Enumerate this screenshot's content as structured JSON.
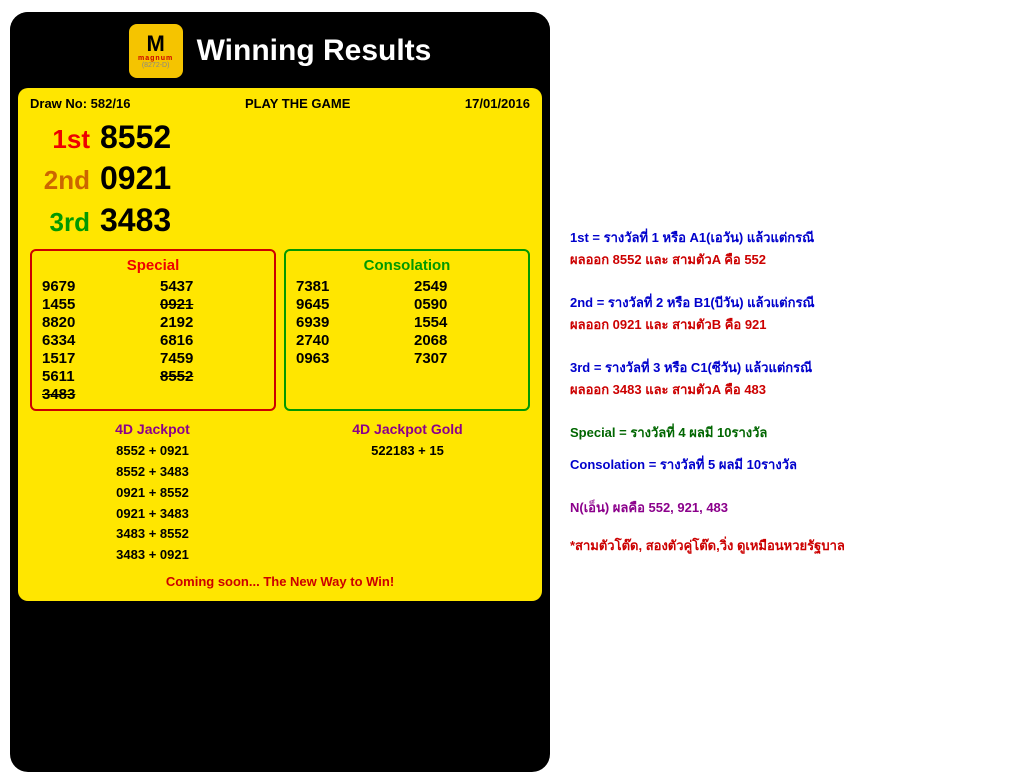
{
  "header": {
    "title": "Winning Results",
    "logo_m": "M",
    "logo_magnum": "magnum",
    "logo_sub": "(8272-D)"
  },
  "draw": {
    "draw_no_label": "Draw No: 582/16",
    "play_label": "PLAY THE GAME",
    "date": "17/01/2016"
  },
  "main_results": {
    "first": {
      "rank": "1st",
      "number": "8552"
    },
    "second": {
      "rank": "2nd",
      "number": "0921"
    },
    "third": {
      "rank": "3rd",
      "number": "3483"
    }
  },
  "special": {
    "title": "Special",
    "numbers": [
      "9679",
      "5437",
      "1455",
      "0921",
      "8820",
      "2192",
      "6334",
      "6816",
      "1517",
      "7459",
      "5611",
      "8552",
      "3483",
      ""
    ],
    "strikethrough": [
      "0921",
      "8552",
      "3483"
    ]
  },
  "consolation": {
    "title": "Consolation",
    "numbers": [
      "7381",
      "2549",
      "9645",
      "0590",
      "6939",
      "1554",
      "2740",
      "2068",
      "0963",
      "7307"
    ]
  },
  "jackpot": {
    "title": "4D Jackpot",
    "combinations": [
      "8552 + 0921",
      "8552 + 3483",
      "0921 + 8552",
      "0921 + 3483",
      "3483 + 8552",
      "3483 + 0921"
    ]
  },
  "jackpot_gold": {
    "title": "4D Jackpot Gold",
    "value": "522183 + 15"
  },
  "coming_soon": "Coming soon... The New Way to Win!",
  "annotations": {
    "line1": "1st = รางวัลที่ 1 หรือ A1(เอวัน) แล้วแต่กรณี",
    "line2": "ผลออก 8552  และ   สามตัวA คือ 552",
    "line3": "2nd = รางวัลที่ 2 หรือ B1(บีวัน) แล้วแต่กรณี",
    "line4": "ผลออก 0921  และ   สามตัวB คือ 921",
    "line5": "3rd = รางวัลที่ 3 หรือ C1(ซีวัน) แล้วแต่กรณี",
    "line6": "ผลออก 3483  และ   สามตัวA คือ 483",
    "line7": "Special = รางวัลที่ 4 ผลมี 10รางวัล",
    "line8": "Consolation = รางวัลที่ 5 ผลมี 10รางวัล",
    "line9": "N(เอ็น) ผลคือ 552, 921, 483",
    "bottom": "*สามตัวโต๊ด, สองตัวคู่โต๊ด,วิ่ง ดูเหมือนหวยรัฐบาล"
  }
}
